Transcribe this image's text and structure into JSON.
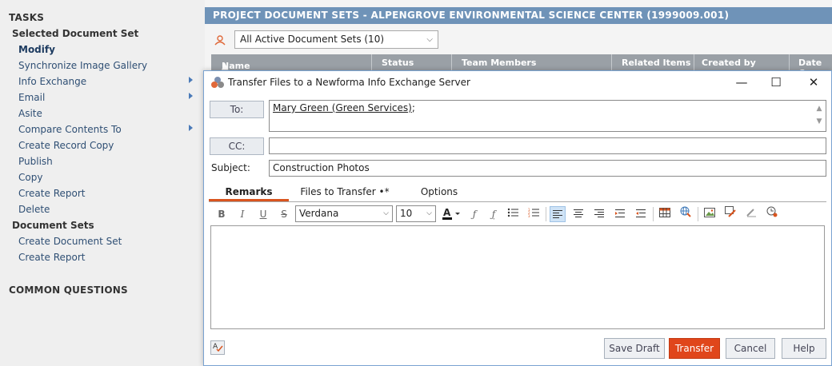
{
  "tasks": {
    "title": "TASKS",
    "selected_heading": "Selected Document Set",
    "selected_items": [
      {
        "label": "Modify",
        "bold": true,
        "submenu": false
      },
      {
        "label": "Synchronize Image Gallery",
        "submenu": false
      },
      {
        "label": "Info Exchange",
        "submenu": true
      },
      {
        "label": "Email",
        "submenu": true
      },
      {
        "label": "Asite",
        "submenu": false
      },
      {
        "label": "Compare Contents To",
        "submenu": true
      },
      {
        "label": "Create Record Copy",
        "submenu": false
      },
      {
        "label": "Publish",
        "submenu": false
      },
      {
        "label": "Copy",
        "submenu": false
      },
      {
        "label": "Create Report",
        "submenu": false
      },
      {
        "label": "Delete",
        "submenu": false
      }
    ],
    "sets_heading": "Document Sets",
    "sets_items": [
      {
        "label": "Create Document Set"
      },
      {
        "label": "Create Report"
      }
    ],
    "common_questions": "COMMON QUESTIONS"
  },
  "project": {
    "title": "PROJECT DOCUMENT SETS - ALPENGROVE ENVIRONMENTAL SCIENCE CENTER (1999009.001)",
    "filter_value": "All Active Document Sets (10)",
    "columns": [
      "Name",
      "Status",
      "Team Members",
      "Related Items",
      "Created by",
      "Date Cr"
    ]
  },
  "dialog": {
    "title": "Transfer Files to a Newforma Info Exchange Server",
    "to_label": "To:",
    "to_value": "Mary Green (Green Services)",
    "to_suffix": ";",
    "cc_label": "CC:",
    "cc_value": "",
    "subject_label": "Subject:",
    "subject_value": "Construction Photos",
    "tabs": [
      {
        "label": "Remarks",
        "active": true
      },
      {
        "label": "Files to Transfer •*",
        "active": false
      },
      {
        "label": "Options",
        "active": false
      }
    ],
    "toolbar": {
      "font": "Verdana",
      "size": "10",
      "bold": "B",
      "italic": "I",
      "underline": "U",
      "strike": "S"
    },
    "buttons": {
      "save_draft": "Save Draft",
      "transfer": "Transfer",
      "cancel": "Cancel",
      "help": "Help"
    },
    "colors": {
      "accent": "#e0461b",
      "title_bar": "#6f93b8"
    }
  }
}
